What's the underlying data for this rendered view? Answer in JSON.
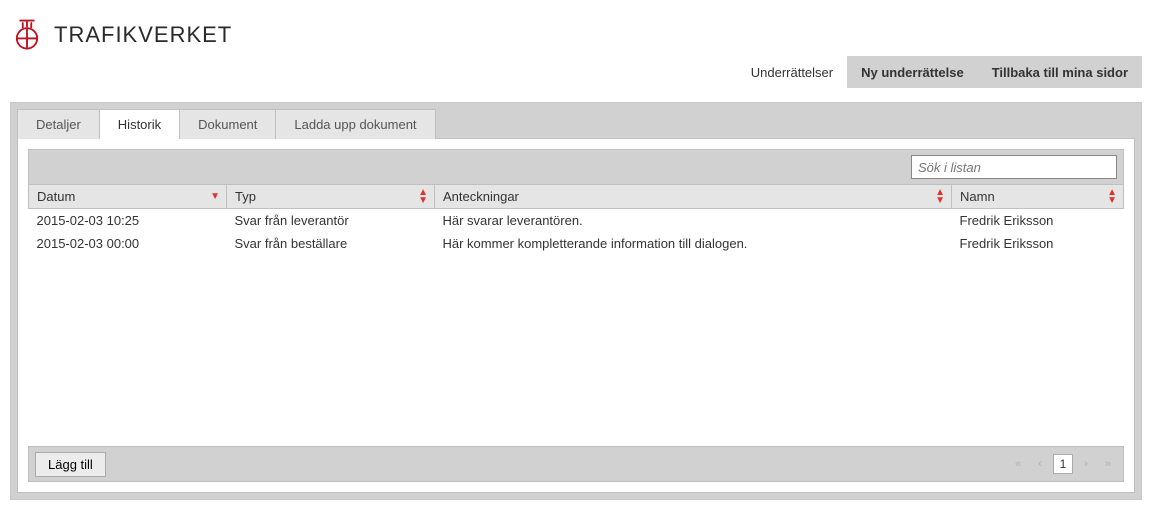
{
  "brand": {
    "name": "TRAFIKVERKET"
  },
  "topnav": {
    "underrattelser": "Underrättelser",
    "ny_underrattelse": "Ny underrättelse",
    "tillbaka": "Tillbaka till mina sidor"
  },
  "tabs": {
    "detaljer": "Detaljer",
    "historik": "Historik",
    "dokument": "Dokument",
    "ladda_upp": "Ladda upp dokument"
  },
  "search": {
    "placeholder": "Sök i listan"
  },
  "columns": {
    "datum": "Datum",
    "typ": "Typ",
    "anteckningar": "Anteckningar",
    "namn": "Namn"
  },
  "rows": [
    {
      "datum": "2015-02-03 10:25",
      "typ": "Svar från leverantör",
      "anteckningar": "Här svarar leverantören.",
      "namn": "Fredrik Eriksson"
    },
    {
      "datum": "2015-02-03 00:00",
      "typ": "Svar från beställare",
      "anteckningar": "Här kommer kompletterande information till dialogen.",
      "namn": "Fredrik Eriksson"
    }
  ],
  "footer": {
    "add": "Lägg till",
    "page": "1"
  }
}
